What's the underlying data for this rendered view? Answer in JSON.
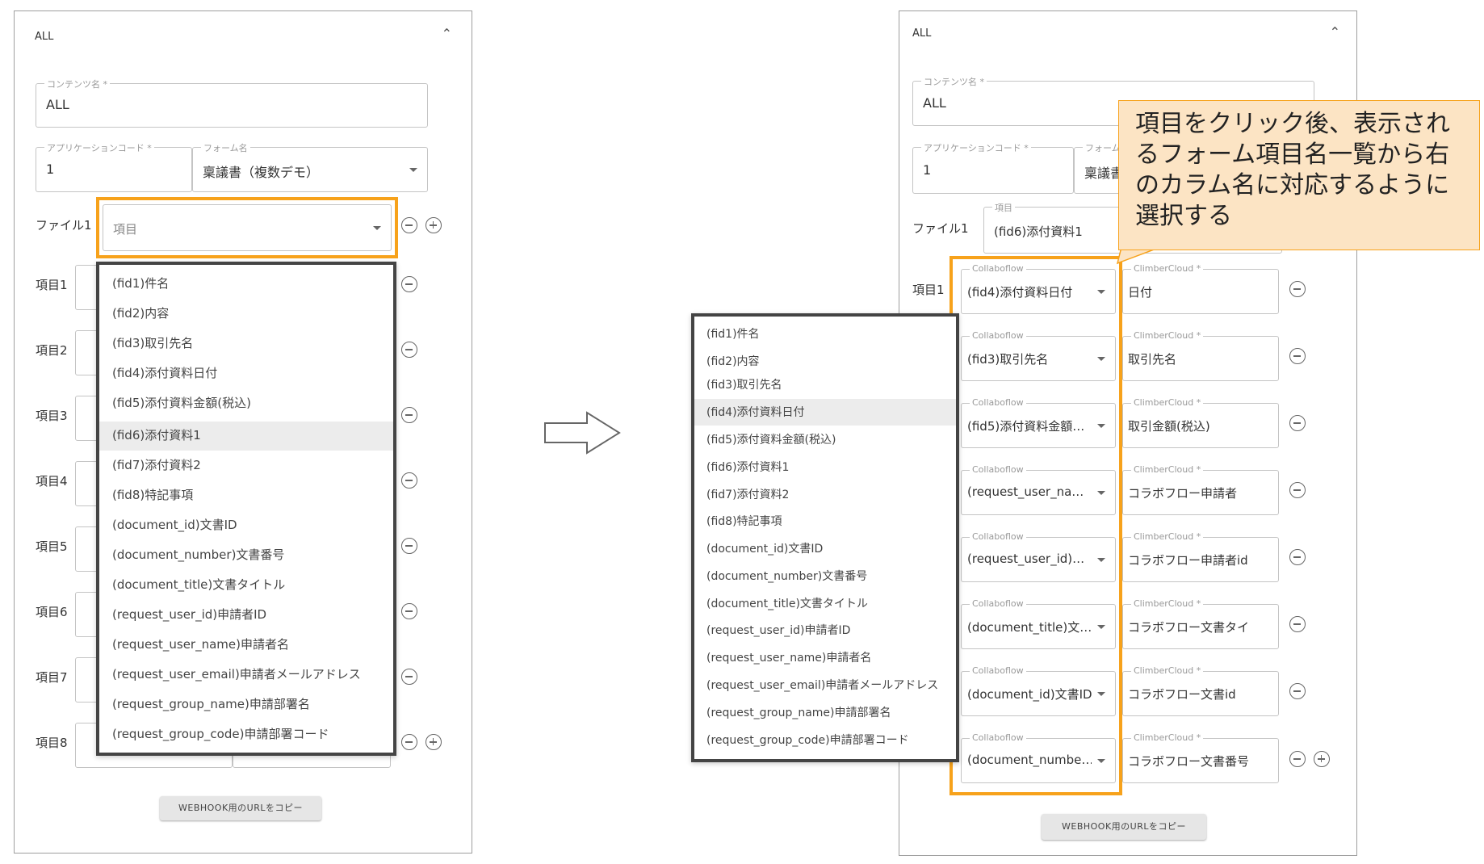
{
  "left_panel": {
    "title": "ALL",
    "content_name": {
      "label": "コンテンツ名 *",
      "value": "ALL"
    },
    "app_code": {
      "label": "アプリケーションコード *",
      "value": "1"
    },
    "form_name": {
      "label": "フォーム名",
      "value": "稟議書（複数デモ）"
    },
    "file_label": "ファイル1",
    "file_select_placeholder": "項目",
    "rows": [
      "項目1",
      "項目2",
      "項目3",
      "項目4",
      "項目5",
      "項目6",
      "項目7",
      "項目8"
    ],
    "button": "WEBHOOK用のURLをコピー",
    "dropdown_items": [
      "(fid1)件名",
      "(fid2)内容",
      "(fid3)取引先名",
      "(fid4)添付資料日付",
      "(fid5)添付資料金額(税込)",
      "(fid6)添付資料1",
      "(fid7)添付資料2",
      "(fid8)特記事項",
      "(document_id)文書ID",
      "(document_number)文書番号",
      "(document_title)文書タイトル",
      "(request_user_id)申請者ID",
      "(request_user_name)申請者名",
      "(request_user_email)申請者メールアドレス",
      "(request_group_name)申請部署名",
      "(request_group_code)申請部署コード"
    ],
    "dropdown_highlight_index": 5
  },
  "right_panel": {
    "title": "ALL",
    "content_name": {
      "label": "コンテンツ名 *",
      "value": "ALL"
    },
    "app_code": {
      "label": "アプリケーションコード *",
      "value": "1"
    },
    "form_name": {
      "label": "フォーム名",
      "value": "稟議書"
    },
    "file_label": "ファイル1",
    "file_select": {
      "label": "項目",
      "value": "(fid6)添付資料1"
    },
    "row1_label": "項目1",
    "collab_label": "Collaboflow",
    "climber_label": "ClimberCloud *",
    "mappings": [
      {
        "collab": "(fid4)添付資料日付",
        "climber": "日付"
      },
      {
        "collab": "(fid3)取引先名",
        "climber": "取引先名"
      },
      {
        "collab": "(fid5)添付資料金額…",
        "climber": "取引金額(税込)"
      },
      {
        "collab": "(request_user_na…",
        "climber": "コラボフロー申請者"
      },
      {
        "collab": "(request_user_id)…",
        "climber": "コラボフロー申請者id"
      },
      {
        "collab": "(document_title)文…",
        "climber": "コラボフロー文書タイ"
      },
      {
        "collab": "(document_id)文書ID",
        "climber": "コラボフロー文書id"
      },
      {
        "collab": "(document_numbe…",
        "climber": "コラボフロー文書番号"
      }
    ],
    "button": "WEBHOOK用のURLをコピー",
    "dropdown_items": [
      "(fid1)件名",
      "(fid2)内容",
      "(fid3)取引先名",
      "(fid4)添付資料日付",
      "(fid5)添付資料金額(税込)",
      "(fid6)添付資料1",
      "(fid7)添付資料2",
      "(fid8)特記事項",
      "(document_id)文書ID",
      "(document_number)文書番号",
      "(document_title)文書タイトル",
      "(request_user_id)申請者ID",
      "(request_user_name)申請者名",
      "(request_user_email)申請者メールアドレス",
      "(request_group_name)申請部署名",
      "(request_group_code)申請部署コード"
    ],
    "dropdown_highlight_index": 3
  },
  "callout": "項目をクリック後、表示されるフォーム項目名一覧から右のカラム名に対応するように選択する",
  "colors": {
    "accent": "#f7a21b",
    "callout_bg": "#fce4c4",
    "dropdown_border": "#444444"
  },
  "icons": [
    "chevron-up-icon",
    "remove-circle-icon",
    "add-circle-icon",
    "arrow-right-icon"
  ]
}
